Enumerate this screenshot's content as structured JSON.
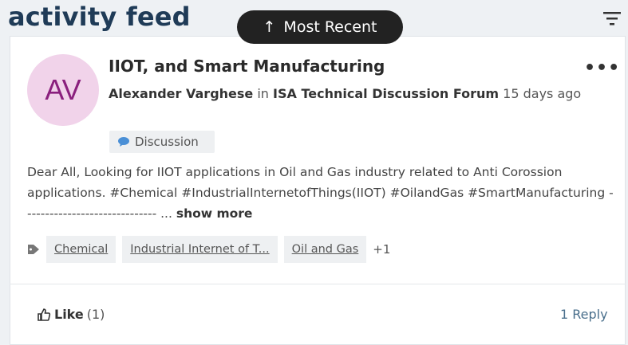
{
  "header": {
    "title": "activity feed",
    "sort_label": "Most Recent",
    "filter_icon": "filter-icon"
  },
  "post": {
    "avatar_initials": "AV",
    "title": "IIOT, and Smart Manufacturing",
    "author": "Alexander Varghese",
    "in_word": "in",
    "forum": "ISA Technical Discussion Forum",
    "time": "15 days ago",
    "badge": "Discussion",
    "body": "Dear All, Looking for IIOT applications in Oil and Gas industry related to Anti Corossion applications. #Chemical #IndustrialInternetofThings(IIOT) #OilandGas #SmartManufacturing ------------------------------ ...",
    "show_more": "show more",
    "tags": [
      "Chemical",
      "Industrial Internet of T...",
      "Oil and Gas"
    ],
    "tags_more": "+1",
    "like_label": "Like",
    "like_count": "(1)",
    "reply_label": "1 Reply"
  },
  "colors": {
    "title": "#1f3b57",
    "avatar_bg": "#f1d3ea",
    "avatar_text": "#8a1f7d",
    "reply_link": "#4a6f8c"
  }
}
